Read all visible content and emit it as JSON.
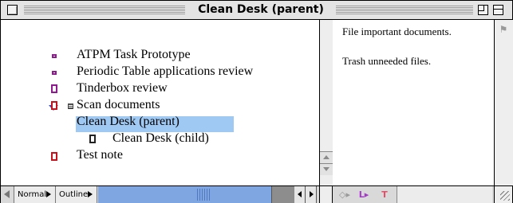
{
  "window": {
    "title": "Clean Desk (parent)"
  },
  "outline": {
    "items": [
      {
        "label": "ATPM Task Prototype",
        "icon": "flat-note-icon",
        "color": "#8f1a8f"
      },
      {
        "label": "Periodic Table applications review",
        "icon": "flat-note-icon",
        "color": "#8f1a8f"
      },
      {
        "label": "Tinderbox review",
        "icon": "document-note-icon",
        "color": "#8f1a8f"
      },
      {
        "label": "Scan documents",
        "icon": "flat-note-icon",
        "color": "#c4121f"
      },
      {
        "label": "Clean Desk (parent)",
        "icon": "document-note-icon",
        "color": "#c4121f",
        "expanded": true,
        "selected": true
      },
      {
        "label": "Clean Desk (child)",
        "icon": "document-note-icon",
        "color": "#222222"
      },
      {
        "label": "Test note",
        "icon": "document-note-icon",
        "color": "#c4121f"
      }
    ],
    "selection_color": "#9fc8f2"
  },
  "text_pane": {
    "paragraph1": "File important documents.",
    "paragraph2": "Trash unneeded files."
  },
  "bottom_bar": {
    "view_popup": "Normal",
    "mode_popup": "Outline",
    "scroll_color": "#7fa6e0"
  }
}
